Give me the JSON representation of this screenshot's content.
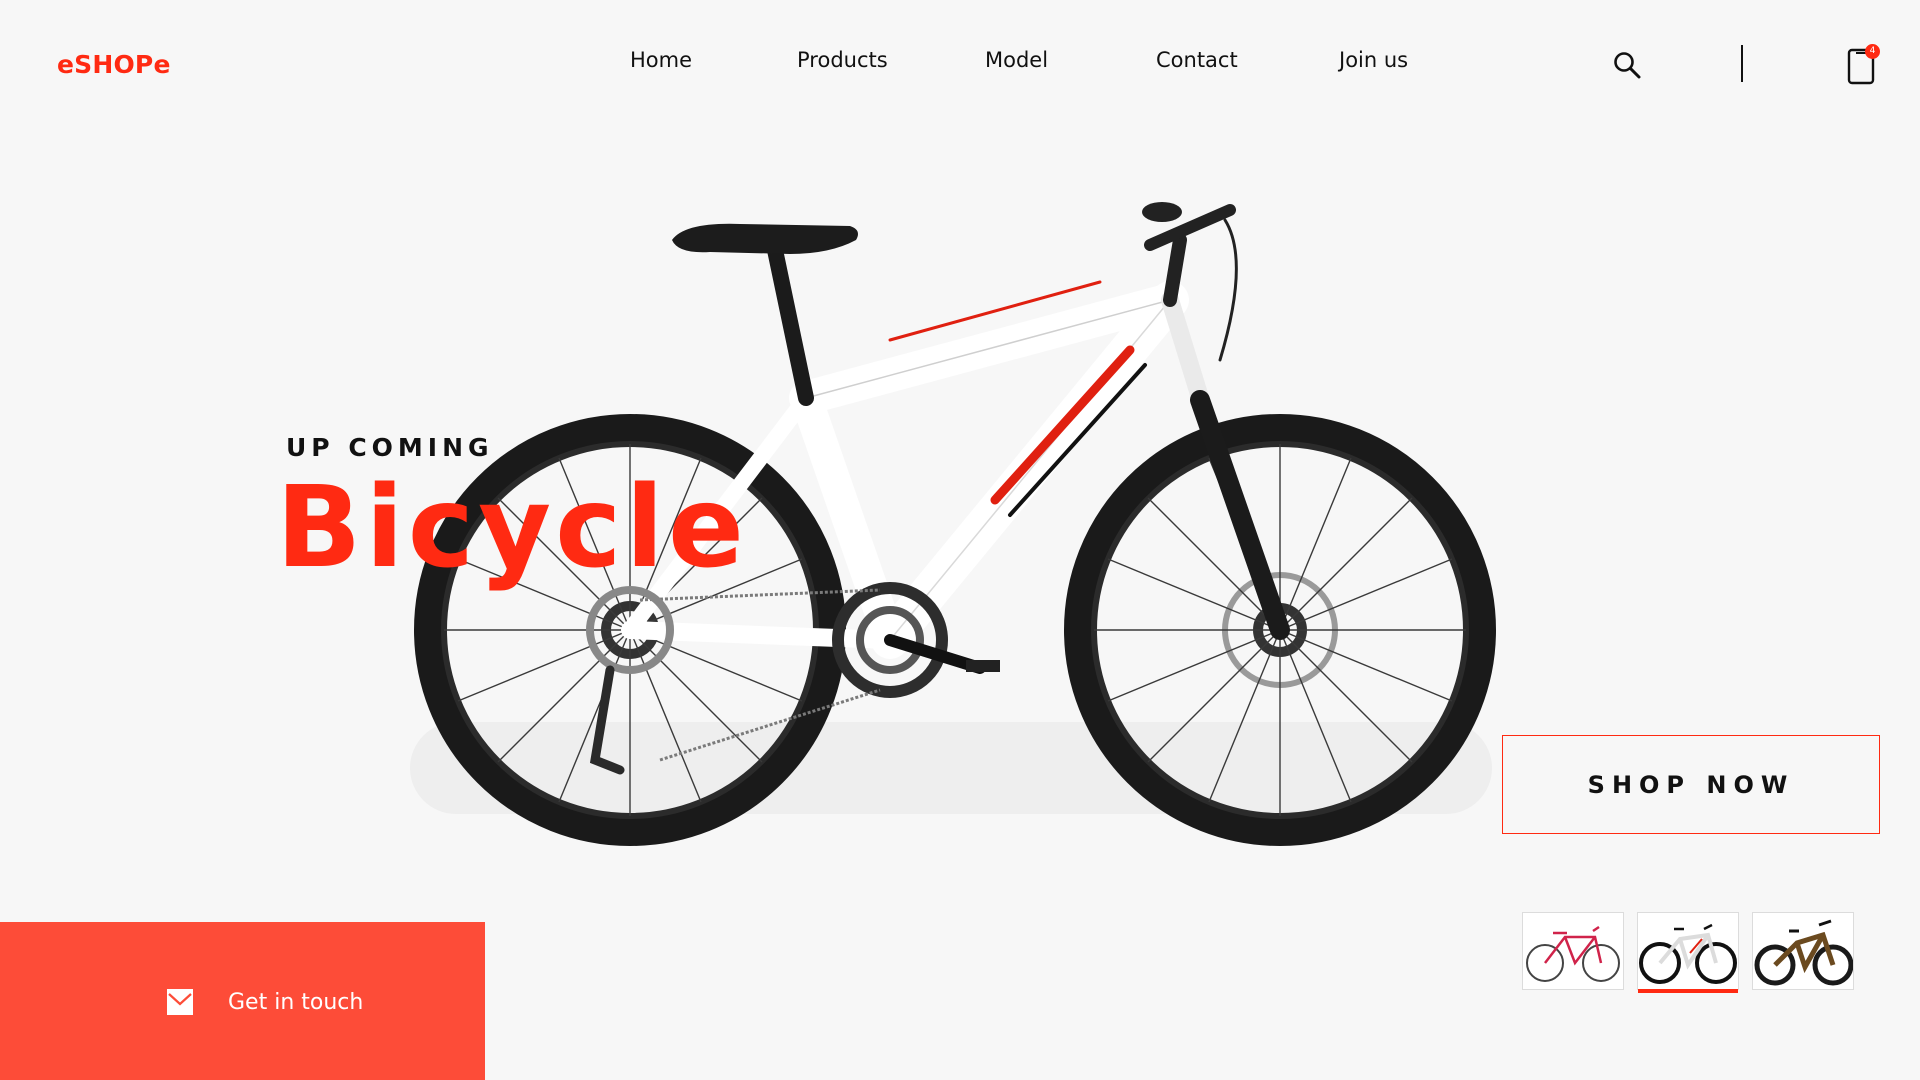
{
  "header": {
    "logo": "eSHOPe",
    "nav": [
      {
        "label": "Home"
      },
      {
        "label": "Products"
      },
      {
        "label": "Model"
      },
      {
        "label": "Contact"
      },
      {
        "label": "Join us"
      }
    ],
    "cart_count": "4"
  },
  "hero": {
    "eyebrow": "UP COMING",
    "title": "Bicycle",
    "cta": "SHOP   NOW"
  },
  "contact": {
    "label": "Get in touch"
  },
  "thumbnails": [
    {
      "name": "road-bike",
      "active": false
    },
    {
      "name": "mountain-bike-white",
      "active": true
    },
    {
      "name": "downhill-bike",
      "active": false
    }
  ],
  "colors": {
    "accent": "#ff2a12",
    "panel": "#fd4c38",
    "background": "#f7f7f7",
    "text": "#111111"
  },
  "icons": [
    "search-icon",
    "cart-icon",
    "mail-icon"
  ]
}
